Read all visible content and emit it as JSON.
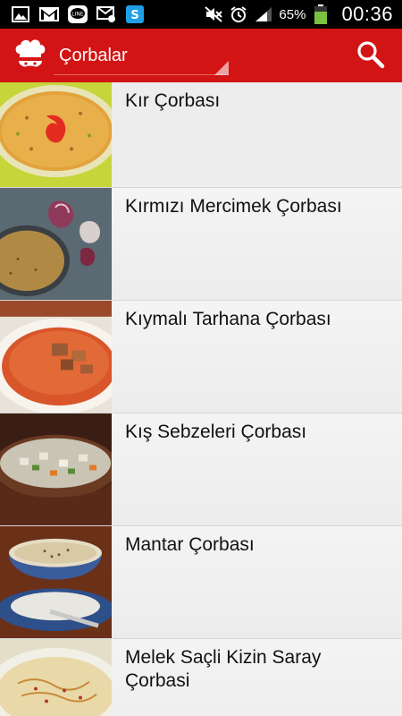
{
  "status_bar": {
    "battery_percent": "65%",
    "time": "00:36"
  },
  "app_bar": {
    "title": "Çorbalar",
    "brand_color": "#d21414"
  },
  "recipes": [
    {
      "name": "Kır Çorbası",
      "image": "kir-corbasi-image"
    },
    {
      "name": "Kırmızı Mercimek Çorbası",
      "image": "mercimek-corbasi-image"
    },
    {
      "name": "Kıymalı Tarhana Çorbası",
      "image": "tarhana-corbasi-image"
    },
    {
      "name": "Kış Sebzeleri Çorbası",
      "image": "sebze-corbasi-image"
    },
    {
      "name": "Mantar Çorbası",
      "image": "mantar-corbasi-image"
    },
    {
      "name": "Melek Saçli Kizin Saray Çorbasi",
      "image": "saray-corbasi-image"
    }
  ]
}
